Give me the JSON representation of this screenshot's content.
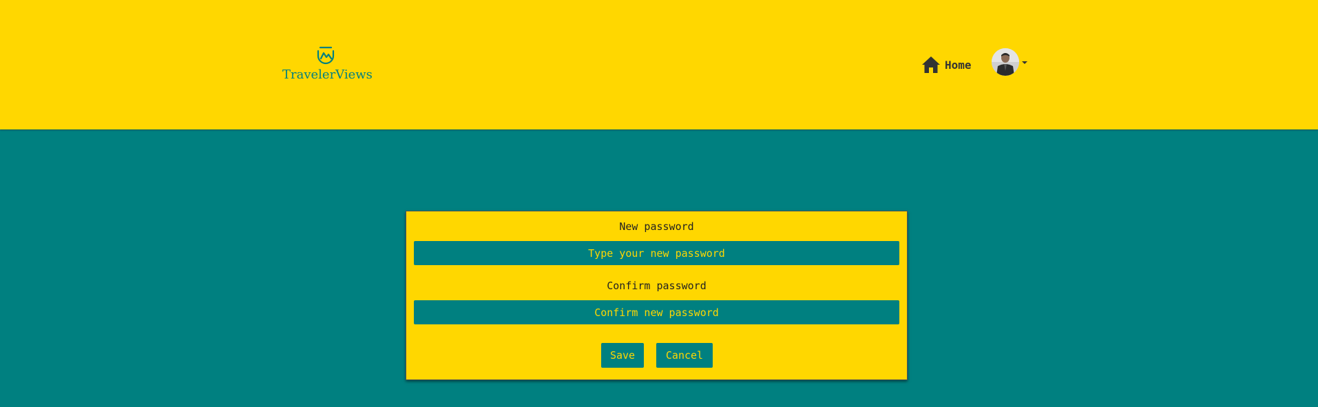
{
  "navbar": {
    "brand": "TravelerViews",
    "brand_icon": "mountain-shield-logo-icon",
    "home_label": "Home",
    "home_icon": "home-icon",
    "user_menu_icon": "caret-down-icon"
  },
  "form": {
    "new_password_label": "New password",
    "new_password_placeholder": "Type your new password",
    "confirm_password_label": "Confirm password",
    "confirm_password_placeholder": "Confirm new password",
    "save_label": "Save",
    "cancel_label": "Cancel"
  },
  "colors": {
    "primary_yellow": "#FFD700",
    "primary_teal": "#008080"
  }
}
